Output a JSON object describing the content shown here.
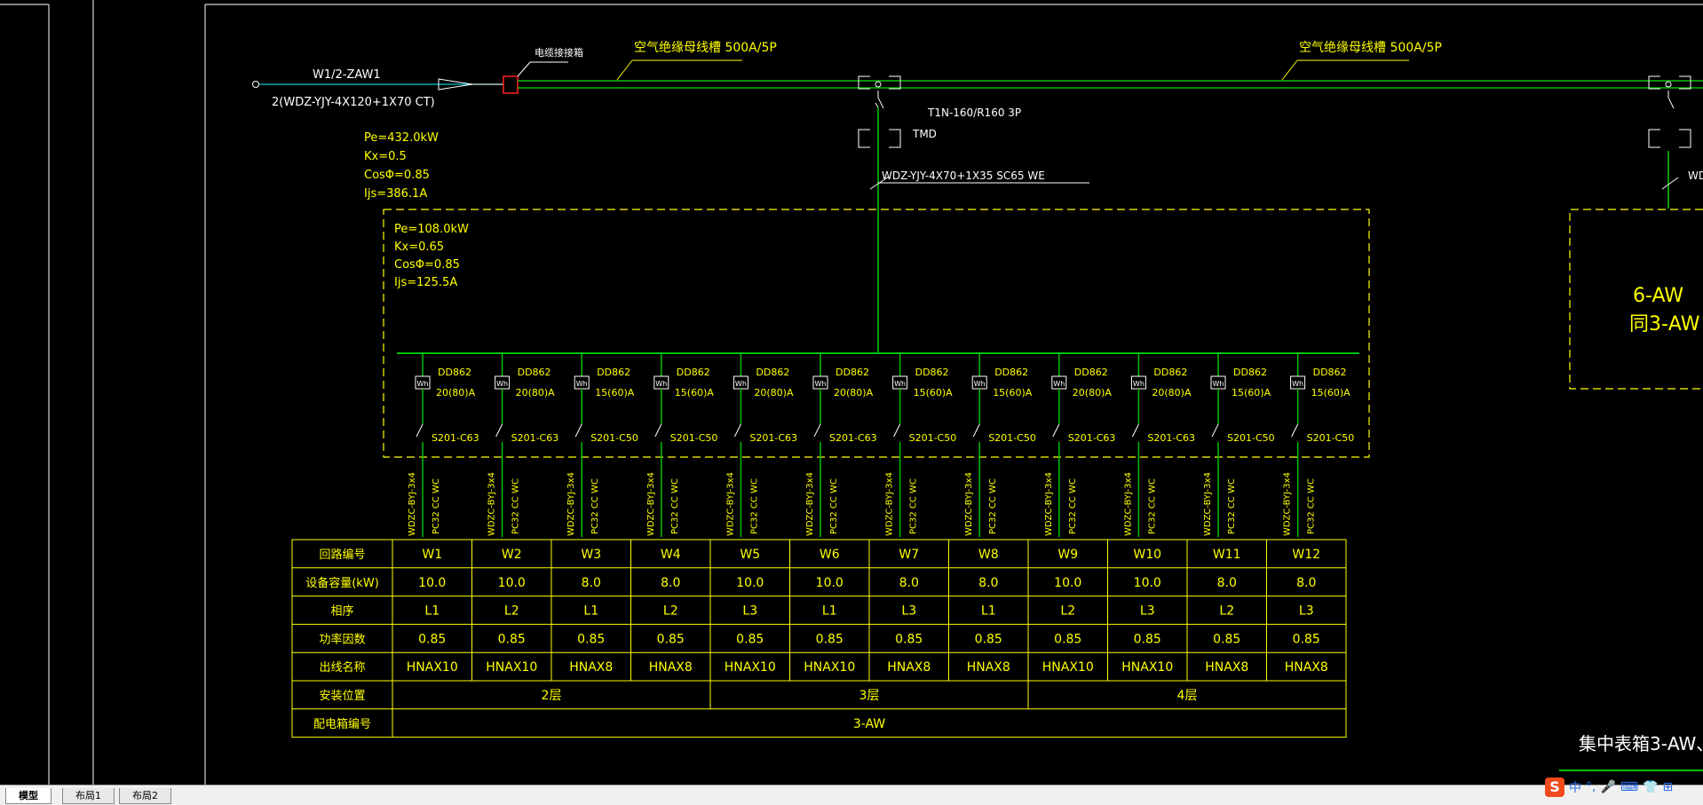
{
  "feeder": {
    "id": "W1/2-ZAW1",
    "cable": "2(WDZ-YJY-4X120+1X70 CT)",
    "grounding_label": "电缆接接箱",
    "busway_1": "空气绝缘母线槽 500A/5P",
    "busway_2": "空气绝缘母线槽 500A/5P",
    "pe": "Pe=432.0kW",
    "kx": "Kx=0.5",
    "cos": "CosΦ=0.85",
    "ijs": "Ijs=386.1A"
  },
  "tap": {
    "breaker": "T1N-160/R160 3P",
    "tmd": "TMD",
    "cable": "WDZ-YJY-4X70+1X35 SC65 WE",
    "right_cable_partial": "WDZ"
  },
  "box": {
    "pe": "Pe=108.0kW",
    "kx": "Kx=0.65",
    "cos": "CosΦ=0.85",
    "ijs": "Ijs=125.5A"
  },
  "circuits": [
    {
      "meter": "DD862",
      "rating": "20(80)A",
      "breaker": "S201-C63",
      "cable": "WDZC-BYJ-3x4",
      "conduit": "PC32 CC WC"
    },
    {
      "meter": "DD862",
      "rating": "20(80)A",
      "breaker": "S201-C63",
      "cable": "WDZC-BYJ-3x4",
      "conduit": "PC32 CC WC"
    },
    {
      "meter": "DD862",
      "rating": "15(60)A",
      "breaker": "S201-C50",
      "cable": "WDZC-BYJ-3x4",
      "conduit": "PC32 CC WC"
    },
    {
      "meter": "DD862",
      "rating": "15(60)A",
      "breaker": "S201-C50",
      "cable": "WDZC-BYJ-3x4",
      "conduit": "PC32 CC WC"
    },
    {
      "meter": "DD862",
      "rating": "20(80)A",
      "breaker": "S201-C63",
      "cable": "WDZC-BYJ-3x4",
      "conduit": "PC32 CC WC"
    },
    {
      "meter": "DD862",
      "rating": "20(80)A",
      "breaker": "S201-C63",
      "cable": "WDZC-BYJ-3x4",
      "conduit": "PC32 CC WC"
    },
    {
      "meter": "DD862",
      "rating": "15(60)A",
      "breaker": "S201-C50",
      "cable": "WDZC-BYJ-3x4",
      "conduit": "PC32 CC WC"
    },
    {
      "meter": "DD862",
      "rating": "15(60)A",
      "breaker": "S201-C50",
      "cable": "WDZC-BYJ-3x4",
      "conduit": "PC32 CC WC"
    },
    {
      "meter": "DD862",
      "rating": "20(80)A",
      "breaker": "S201-C63",
      "cable": "WDZC-BYJ-3x4",
      "conduit": "PC32 CC WC"
    },
    {
      "meter": "DD862",
      "rating": "20(80)A",
      "breaker": "S201-C63",
      "cable": "WDZC-BYJ-3x4",
      "conduit": "PC32 CC WC"
    },
    {
      "meter": "DD862",
      "rating": "15(60)A",
      "breaker": "S201-C50",
      "cable": "WDZC-BYJ-3x4",
      "conduit": "PC32 CC WC"
    },
    {
      "meter": "DD862",
      "rating": "15(60)A",
      "breaker": "S201-C50",
      "cable": "WDZC-BYJ-3x4",
      "conduit": "PC32 CC WC"
    }
  ],
  "meter_symbol": "Wh",
  "table": {
    "row_headers": [
      "回路编号",
      "设备容量(kW)",
      "相序",
      "功率因数",
      "出线名称",
      "安装位置",
      "配电箱编号"
    ],
    "circuit_ids": [
      "W1",
      "W2",
      "W3",
      "W4",
      "W5",
      "W6",
      "W7",
      "W8",
      "W9",
      "W10",
      "W11",
      "W12"
    ],
    "capacity": [
      "10.0",
      "10.0",
      "8.0",
      "8.0",
      "10.0",
      "10.0",
      "8.0",
      "8.0",
      "10.0",
      "10.0",
      "8.0",
      "8.0"
    ],
    "phase": [
      "L1",
      "L2",
      "L1",
      "L2",
      "L3",
      "L1",
      "L3",
      "L1",
      "L2",
      "L3",
      "L2",
      "L3"
    ],
    "power_factor": [
      "0.85",
      "0.85",
      "0.85",
      "0.85",
      "0.85",
      "0.85",
      "0.85",
      "0.85",
      "0.85",
      "0.85",
      "0.85",
      "0.85"
    ],
    "outgoing": [
      "HNAX10",
      "HNAX10",
      "HNAX8",
      "HNAX8",
      "HNAX10",
      "HNAX10",
      "HNAX8",
      "HNAX8",
      "HNAX10",
      "HNAX10",
      "HNAX8",
      "HNAX8"
    ],
    "locations": [
      "2层",
      "3层",
      "4层"
    ],
    "panel": "3-AW"
  },
  "right_box": {
    "line1": "6-AW",
    "line2": "同3-AW"
  },
  "bottom_right_title": "集中表箱3-AW、",
  "tabs": [
    "模型",
    "布局1",
    "布局2"
  ],
  "ime": {
    "logo": "S",
    "items": [
      "中",
      "°,",
      "🎤",
      "⌨",
      "👕",
      "⊞"
    ]
  },
  "colors": {
    "background": "#000000",
    "annotation": "#ffff00",
    "bus": "#00c000",
    "feeder_line": "#00c8c8",
    "frame": "#ffffff",
    "grounding_box": "#ff0000"
  }
}
